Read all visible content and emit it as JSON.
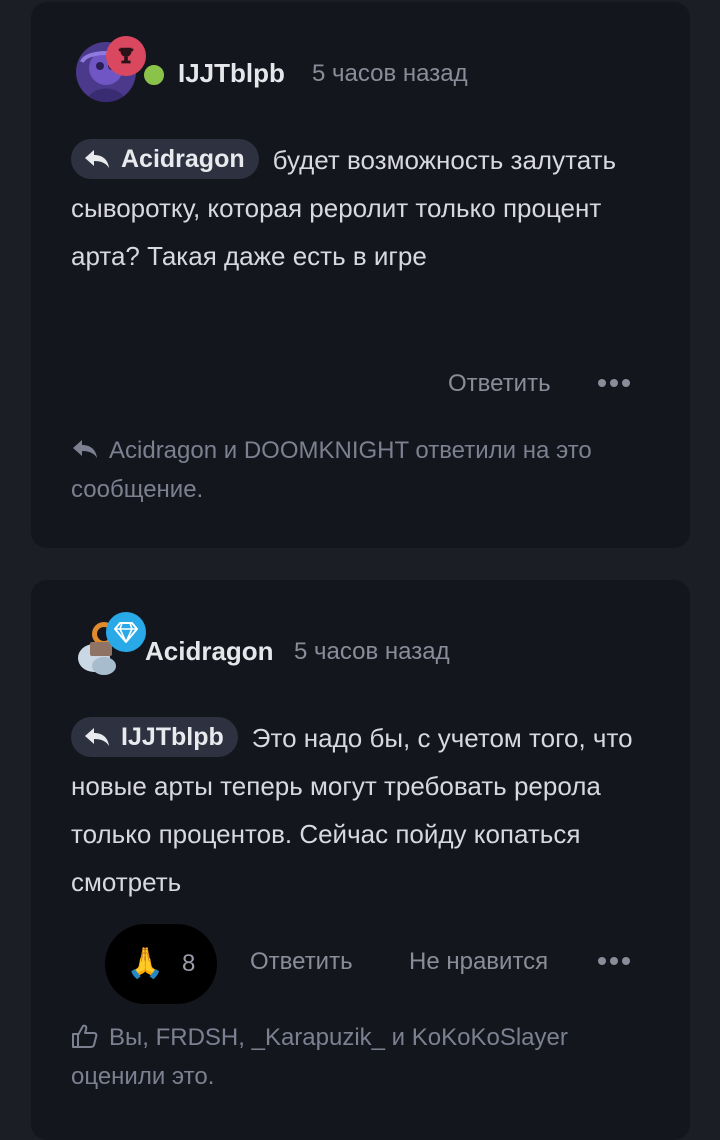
{
  "comments": [
    {
      "author": "IJJTblpb",
      "time": "5 часов назад",
      "reply_to": "Acidragon",
      "text": "будет возможность залутать сыворотку, которая реролит только процент арта? Такая даже есть в игре",
      "actions": {
        "reply": "Ответить"
      },
      "footer": "Acidragon и DOOMKNIGHT ответили на это сообщение.",
      "colors": {
        "badge": "#d9485f",
        "online": "#8bc34a"
      },
      "badge_icon": "trophy-icon"
    },
    {
      "author": "Acidragon",
      "time": "5 часов назад",
      "reply_to": "IJJTblpb",
      "text": "Это надо бы, с учетом того, что новые арты теперь могут требовать реролa только процентов. Сейчас пойду копаться смотреть",
      "reaction": {
        "emoji": "🙏",
        "count": "8"
      },
      "actions": {
        "reply": "Ответить",
        "dislike": "Не нравится"
      },
      "footer": "Вы, FRDSH, _Karapuzik_ и KoKoKoSlayer оценили это.",
      "colors": {
        "badge": "#29a9e8"
      },
      "badge_icon": "diamond-icon"
    }
  ]
}
